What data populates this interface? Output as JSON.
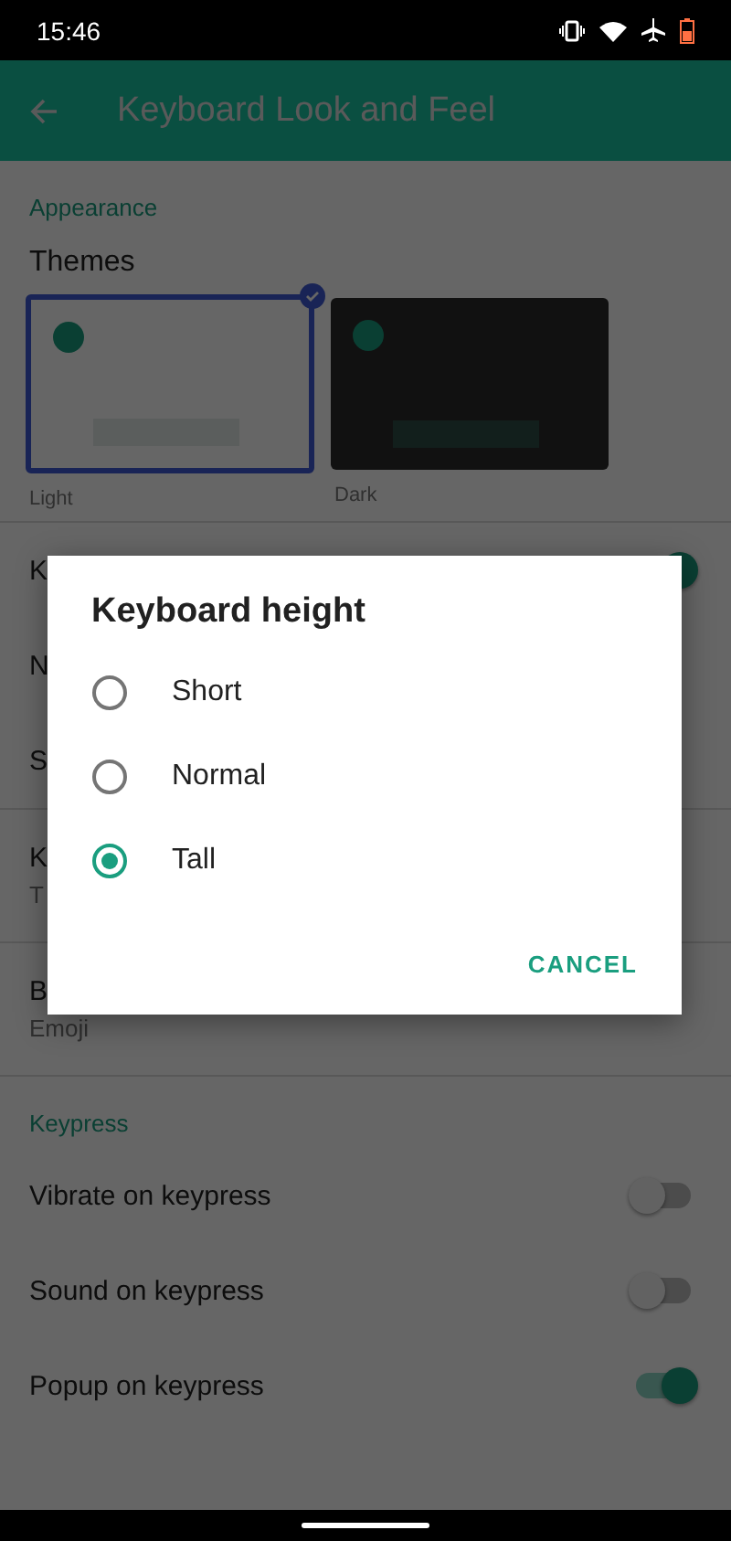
{
  "status_bar": {
    "time": "15:46"
  },
  "app_bar": {
    "title": "Keyboard Look and Feel"
  },
  "appearance": {
    "header": "Appearance",
    "themes_label": "Themes",
    "themes": [
      {
        "name": "Light",
        "kind": "light",
        "selected": true
      },
      {
        "name": "Dark",
        "kind": "dark",
        "selected": false
      }
    ],
    "setting_groups": [
      [
        {
          "title": "K",
          "kind": "toggle",
          "on": true
        },
        {
          "title": "N",
          "kind": "plain"
        },
        {
          "title": "S",
          "kind": "plain"
        }
      ],
      [
        {
          "title": "K",
          "summary": "T",
          "kind": "plain"
        }
      ],
      [
        {
          "title": "B",
          "summary": "Emoji",
          "kind": "plain"
        }
      ]
    ]
  },
  "keypress": {
    "header": "Keypress",
    "settings": [
      {
        "title": "Vibrate on keypress",
        "on": false
      },
      {
        "title": "Sound on keypress",
        "on": false
      },
      {
        "title": "Popup on keypress",
        "on": true
      }
    ]
  },
  "dialog": {
    "title": "Keyboard height",
    "options": [
      {
        "label": "Short",
        "selected": false
      },
      {
        "label": "Normal",
        "selected": false
      },
      {
        "label": "Tall",
        "selected": true
      }
    ],
    "buttons": [
      "CANCEL"
    ]
  }
}
